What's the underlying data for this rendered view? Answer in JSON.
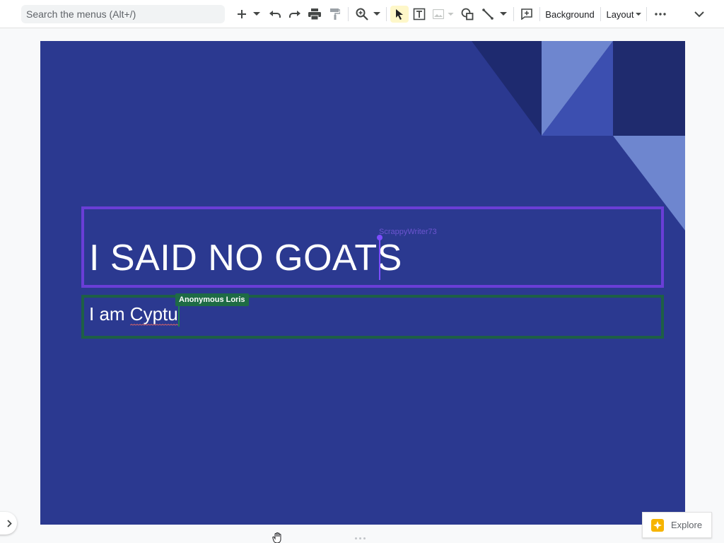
{
  "toolbar": {
    "search_placeholder": "Search the menus (Alt+/)",
    "background_label": "Background",
    "layout_label": "Layout",
    "icons": [
      "plus-icon",
      "undo-icon",
      "redo-icon",
      "print-icon",
      "paint-format-icon",
      "zoom-icon",
      "select-icon",
      "text-box-icon",
      "image-icon",
      "shape-icon",
      "line-icon",
      "comment-icon",
      "more-icon",
      "collapse-icon"
    ]
  },
  "slide": {
    "title": "I SAID NO GOATS",
    "subtitle": "I am Cyptu",
    "collaborators": {
      "title_editor": "ScrappyWriter73",
      "subtitle_editor": "Anonymous Loris"
    },
    "colors": {
      "background": "#2b3990",
      "title_cursor": "#7c4dff",
      "subtitle_cursor": "#1e6b45"
    }
  },
  "explore": {
    "label": "Explore"
  }
}
